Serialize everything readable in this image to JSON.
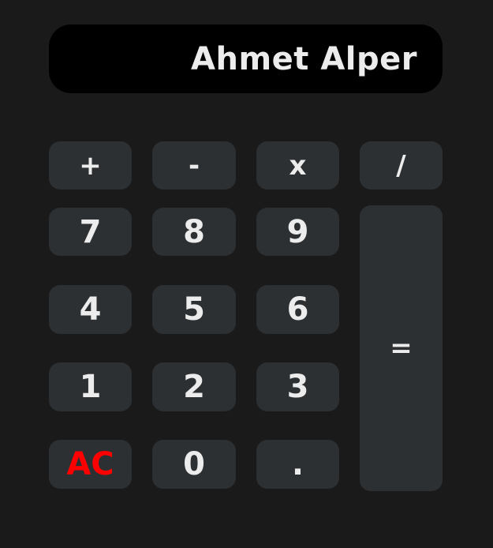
{
  "display": {
    "value": "Ahmet Alper"
  },
  "keys": {
    "plus": "+",
    "minus": "-",
    "multiply": "x",
    "divide": "/",
    "seven": "7",
    "eight": "8",
    "nine": "9",
    "four": "4",
    "five": "5",
    "six": "6",
    "one": "1",
    "two": "2",
    "three": "3",
    "clear": "AC",
    "zero": "0",
    "decimal": ".",
    "equals": "="
  },
  "colors": {
    "background": "#1a1a1a",
    "display_background": "#000000",
    "key_background": "#2d3033",
    "text": "#ececec",
    "clear_text": "#ff0000"
  }
}
